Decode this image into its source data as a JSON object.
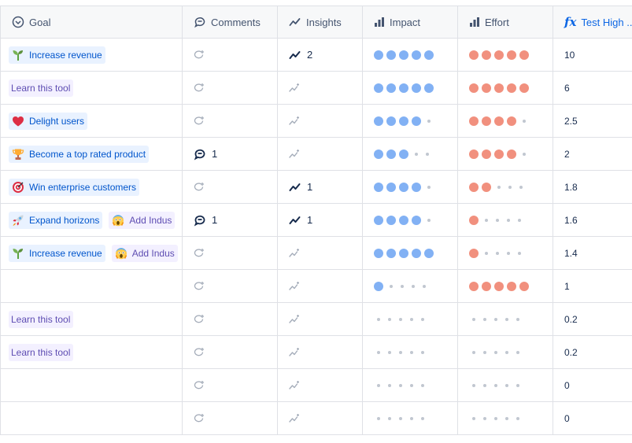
{
  "columns": {
    "goal": "Goal",
    "comments": "Comments",
    "insights": "Insights",
    "impact": "Impact",
    "effort": "Effort",
    "test": "Test High ..."
  },
  "colors": {
    "impact": "#82b1f4",
    "effort": "#f1907e",
    "tag_bg": "#e9f2ff",
    "tag_purple_bg": "#f3f0ff"
  },
  "rows": [
    {
      "goals": [
        {
          "label": "Increase revenue",
          "icon": "seedling-icon"
        }
      ],
      "comments": "",
      "insights": "2",
      "impact": 5,
      "effort": 5,
      "test": "10"
    },
    {
      "goals": [
        {
          "label": "Learn this tool",
          "icon": ""
        }
      ],
      "comments": "",
      "insights": "",
      "impact": 5,
      "effort": 5,
      "test": "6"
    },
    {
      "goals": [
        {
          "label": "Delight users",
          "icon": "heart-icon"
        }
      ],
      "comments": "",
      "insights": "",
      "impact": 4,
      "effort": 4,
      "test": "2.5"
    },
    {
      "goals": [
        {
          "label": "Become a top rated product",
          "icon": "trophy-icon"
        }
      ],
      "comments": "1",
      "insights": "",
      "impact": 3,
      "effort": 4,
      "test": "2"
    },
    {
      "goals": [
        {
          "label": "Win enterprise customers",
          "icon": "target-icon"
        }
      ],
      "comments": "",
      "insights": "1",
      "impact": 4,
      "effort": 2,
      "test": "1.8"
    },
    {
      "goals": [
        {
          "label": "Expand horizons",
          "icon": "rocket-icon"
        },
        {
          "label": "Add Indus",
          "icon": "scream-icon"
        }
      ],
      "comments": "1",
      "insights": "1",
      "impact": 4,
      "effort": 1,
      "test": "1.6"
    },
    {
      "goals": [
        {
          "label": "Increase revenue",
          "icon": "seedling-icon"
        },
        {
          "label": "Add Indus",
          "icon": "scream-icon"
        }
      ],
      "comments": "",
      "insights": "",
      "impact": 5,
      "effort": 1,
      "test": "1.4"
    },
    {
      "goals": [],
      "comments": "",
      "insights": "",
      "impact": 1,
      "effort": 5,
      "test": "1"
    },
    {
      "goals": [
        {
          "label": "Learn this tool",
          "icon": ""
        }
      ],
      "comments": "",
      "insights": "",
      "impact": 0,
      "effort": 0,
      "test": "0.2"
    },
    {
      "goals": [
        {
          "label": "Learn this tool",
          "icon": ""
        }
      ],
      "comments": "",
      "insights": "",
      "impact": 0,
      "effort": 0,
      "test": "0.2"
    },
    {
      "goals": [],
      "comments": "",
      "insights": "",
      "impact": 0,
      "effort": 0,
      "test": "0"
    },
    {
      "goals": [],
      "comments": "",
      "insights": "",
      "impact": 0,
      "effort": 0,
      "test": "0"
    }
  ]
}
